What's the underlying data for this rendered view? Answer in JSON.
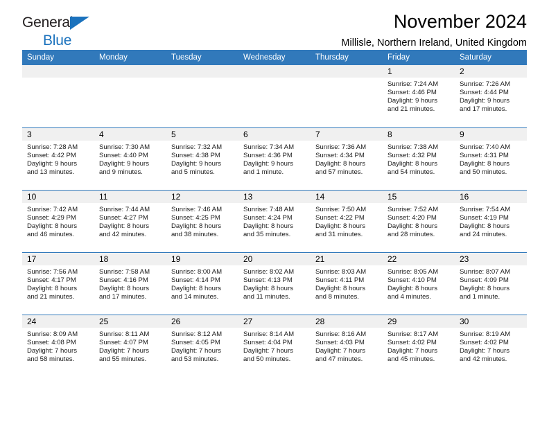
{
  "brand": {
    "line1": "General",
    "line2": "Blue",
    "accent_color": "#1b72bd"
  },
  "header": {
    "title": "November 2024",
    "subtitle": "Millisle, Northern Ireland, United Kingdom"
  },
  "calendar": {
    "header_color": "#3179bb",
    "daynum_band_color": "#f0f0f0",
    "weekdays": [
      "Sunday",
      "Monday",
      "Tuesday",
      "Wednesday",
      "Thursday",
      "Friday",
      "Saturday"
    ],
    "weeks": [
      [
        {
          "day": "",
          "empty": true
        },
        {
          "day": "",
          "empty": true
        },
        {
          "day": "",
          "empty": true
        },
        {
          "day": "",
          "empty": true
        },
        {
          "day": "",
          "empty": true
        },
        {
          "day": "1",
          "sunrise": "Sunrise: 7:24 AM",
          "sunset": "Sunset: 4:46 PM",
          "daylight1": "Daylight: 9 hours",
          "daylight2": "and 21 minutes."
        },
        {
          "day": "2",
          "sunrise": "Sunrise: 7:26 AM",
          "sunset": "Sunset: 4:44 PM",
          "daylight1": "Daylight: 9 hours",
          "daylight2": "and 17 minutes."
        }
      ],
      [
        {
          "day": "3",
          "sunrise": "Sunrise: 7:28 AM",
          "sunset": "Sunset: 4:42 PM",
          "daylight1": "Daylight: 9 hours",
          "daylight2": "and 13 minutes."
        },
        {
          "day": "4",
          "sunrise": "Sunrise: 7:30 AM",
          "sunset": "Sunset: 4:40 PM",
          "daylight1": "Daylight: 9 hours",
          "daylight2": "and 9 minutes."
        },
        {
          "day": "5",
          "sunrise": "Sunrise: 7:32 AM",
          "sunset": "Sunset: 4:38 PM",
          "daylight1": "Daylight: 9 hours",
          "daylight2": "and 5 minutes."
        },
        {
          "day": "6",
          "sunrise": "Sunrise: 7:34 AM",
          "sunset": "Sunset: 4:36 PM",
          "daylight1": "Daylight: 9 hours",
          "daylight2": "and 1 minute."
        },
        {
          "day": "7",
          "sunrise": "Sunrise: 7:36 AM",
          "sunset": "Sunset: 4:34 PM",
          "daylight1": "Daylight: 8 hours",
          "daylight2": "and 57 minutes."
        },
        {
          "day": "8",
          "sunrise": "Sunrise: 7:38 AM",
          "sunset": "Sunset: 4:32 PM",
          "daylight1": "Daylight: 8 hours",
          "daylight2": "and 54 minutes."
        },
        {
          "day": "9",
          "sunrise": "Sunrise: 7:40 AM",
          "sunset": "Sunset: 4:31 PM",
          "daylight1": "Daylight: 8 hours",
          "daylight2": "and 50 minutes."
        }
      ],
      [
        {
          "day": "10",
          "sunrise": "Sunrise: 7:42 AM",
          "sunset": "Sunset: 4:29 PM",
          "daylight1": "Daylight: 8 hours",
          "daylight2": "and 46 minutes."
        },
        {
          "day": "11",
          "sunrise": "Sunrise: 7:44 AM",
          "sunset": "Sunset: 4:27 PM",
          "daylight1": "Daylight: 8 hours",
          "daylight2": "and 42 minutes."
        },
        {
          "day": "12",
          "sunrise": "Sunrise: 7:46 AM",
          "sunset": "Sunset: 4:25 PM",
          "daylight1": "Daylight: 8 hours",
          "daylight2": "and 38 minutes."
        },
        {
          "day": "13",
          "sunrise": "Sunrise: 7:48 AM",
          "sunset": "Sunset: 4:24 PM",
          "daylight1": "Daylight: 8 hours",
          "daylight2": "and 35 minutes."
        },
        {
          "day": "14",
          "sunrise": "Sunrise: 7:50 AM",
          "sunset": "Sunset: 4:22 PM",
          "daylight1": "Daylight: 8 hours",
          "daylight2": "and 31 minutes."
        },
        {
          "day": "15",
          "sunrise": "Sunrise: 7:52 AM",
          "sunset": "Sunset: 4:20 PM",
          "daylight1": "Daylight: 8 hours",
          "daylight2": "and 28 minutes."
        },
        {
          "day": "16",
          "sunrise": "Sunrise: 7:54 AM",
          "sunset": "Sunset: 4:19 PM",
          "daylight1": "Daylight: 8 hours",
          "daylight2": "and 24 minutes."
        }
      ],
      [
        {
          "day": "17",
          "sunrise": "Sunrise: 7:56 AM",
          "sunset": "Sunset: 4:17 PM",
          "daylight1": "Daylight: 8 hours",
          "daylight2": "and 21 minutes."
        },
        {
          "day": "18",
          "sunrise": "Sunrise: 7:58 AM",
          "sunset": "Sunset: 4:16 PM",
          "daylight1": "Daylight: 8 hours",
          "daylight2": "and 17 minutes."
        },
        {
          "day": "19",
          "sunrise": "Sunrise: 8:00 AM",
          "sunset": "Sunset: 4:14 PM",
          "daylight1": "Daylight: 8 hours",
          "daylight2": "and 14 minutes."
        },
        {
          "day": "20",
          "sunrise": "Sunrise: 8:02 AM",
          "sunset": "Sunset: 4:13 PM",
          "daylight1": "Daylight: 8 hours",
          "daylight2": "and 11 minutes."
        },
        {
          "day": "21",
          "sunrise": "Sunrise: 8:03 AM",
          "sunset": "Sunset: 4:11 PM",
          "daylight1": "Daylight: 8 hours",
          "daylight2": "and 8 minutes."
        },
        {
          "day": "22",
          "sunrise": "Sunrise: 8:05 AM",
          "sunset": "Sunset: 4:10 PM",
          "daylight1": "Daylight: 8 hours",
          "daylight2": "and 4 minutes."
        },
        {
          "day": "23",
          "sunrise": "Sunrise: 8:07 AM",
          "sunset": "Sunset: 4:09 PM",
          "daylight1": "Daylight: 8 hours",
          "daylight2": "and 1 minute."
        }
      ],
      [
        {
          "day": "24",
          "sunrise": "Sunrise: 8:09 AM",
          "sunset": "Sunset: 4:08 PM",
          "daylight1": "Daylight: 7 hours",
          "daylight2": "and 58 minutes."
        },
        {
          "day": "25",
          "sunrise": "Sunrise: 8:11 AM",
          "sunset": "Sunset: 4:07 PM",
          "daylight1": "Daylight: 7 hours",
          "daylight2": "and 55 minutes."
        },
        {
          "day": "26",
          "sunrise": "Sunrise: 8:12 AM",
          "sunset": "Sunset: 4:05 PM",
          "daylight1": "Daylight: 7 hours",
          "daylight2": "and 53 minutes."
        },
        {
          "day": "27",
          "sunrise": "Sunrise: 8:14 AM",
          "sunset": "Sunset: 4:04 PM",
          "daylight1": "Daylight: 7 hours",
          "daylight2": "and 50 minutes."
        },
        {
          "day": "28",
          "sunrise": "Sunrise: 8:16 AM",
          "sunset": "Sunset: 4:03 PM",
          "daylight1": "Daylight: 7 hours",
          "daylight2": "and 47 minutes."
        },
        {
          "day": "29",
          "sunrise": "Sunrise: 8:17 AM",
          "sunset": "Sunset: 4:02 PM",
          "daylight1": "Daylight: 7 hours",
          "daylight2": "and 45 minutes."
        },
        {
          "day": "30",
          "sunrise": "Sunrise: 8:19 AM",
          "sunset": "Sunset: 4:02 PM",
          "daylight1": "Daylight: 7 hours",
          "daylight2": "and 42 minutes."
        }
      ]
    ]
  }
}
